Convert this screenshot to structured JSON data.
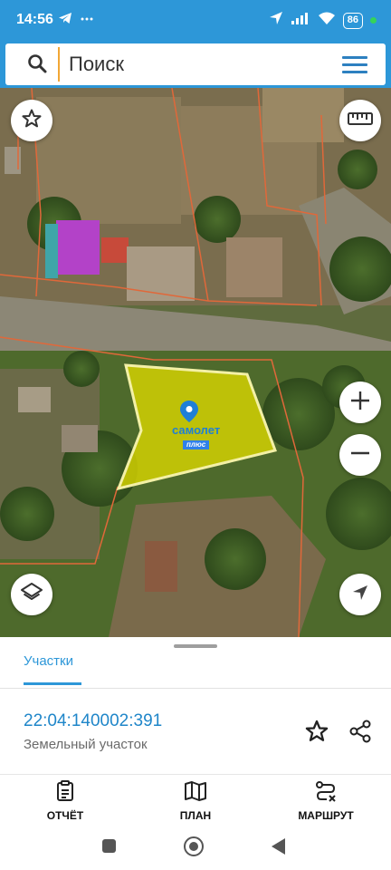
{
  "status_bar": {
    "time": "14:56",
    "left_icons": [
      "telegram-icon",
      "more-icon"
    ],
    "right_icons": [
      "location-icon",
      "signal-icon",
      "wifi-icon"
    ],
    "battery": "86",
    "dot_color": "#35d35a"
  },
  "search": {
    "placeholder": "Поиск"
  },
  "map": {
    "brand_name": "самолет",
    "brand_sub": "плюс",
    "parcel_fill": "#d7d400",
    "boundary_color": "#e0683a",
    "controls": [
      "star-icon",
      "ruler-icon",
      "zoom-in-icon",
      "zoom-out-icon",
      "layers-icon",
      "locate-icon"
    ]
  },
  "sheet": {
    "tab_label": "Участки",
    "parcel_id": "22:04:140002:391",
    "parcel_type": "Земельный участок"
  },
  "bottom_nav": {
    "report_label": "ОТЧЁТ",
    "plan_label": "ПЛАН",
    "route_label": "МАРШРУТ"
  },
  "colors": {
    "accent": "#2d97d8",
    "link": "#1f86c9"
  }
}
